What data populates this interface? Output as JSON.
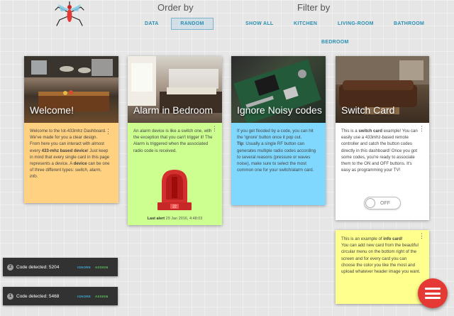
{
  "order_by": {
    "title": "Order by",
    "buttons": [
      {
        "label": "DATA",
        "active": false
      },
      {
        "label": "RANDOM",
        "active": true
      }
    ]
  },
  "filter_by": {
    "title": "Filter by",
    "buttons": [
      {
        "label": "SHOW ALL"
      },
      {
        "label": "KITCHEN"
      },
      {
        "label": "LIVING-ROOM"
      },
      {
        "label": "BATHROOM"
      },
      {
        "label": "BEDROOM"
      }
    ]
  },
  "cards": {
    "welcome": {
      "title": "Welcome!",
      "bg": "#ffd180",
      "body_html": "Welcome to the Iot-433mhz Dashboard. We've made for you a clear design.<br>From here you can interact with almost every <b>433-mhz based device</b>! Just keep in mind that every single card in this page represents a device. A <b>device</b> can be one of three different types: <i>switch, alarm, info</i>."
    },
    "alarm": {
      "title": "Alarm in Bedroom",
      "bg": "#ccff90",
      "body_html": "An alarm device is like a switch one, with the exception that you can't trigger it! The Alarm is triggered when the associated radio code is received.",
      "last_alert_label": "Last alert",
      "last_alert_value": "29 Jan 2016, 4:48:03"
    },
    "noisy": {
      "title": "Ignore Noisy codes",
      "bg": "#80d8ff",
      "body_html": "If you get flooded by a code, you can hit the 'ignore' button once it pop out.<br><b>Tip</b>: Usually a single RF button can generates multiple radio codes according to several reasons (pressure or waves noise), make sure to select the most common one for your switch/alarm card."
    },
    "switch": {
      "title": "Switch Card",
      "bg": "#ffffff",
      "body_html": "This is a <b>switch card</b> example! You can easily use a 433mhz-based remote controller and catch the button codes directly in this dashboard! Once you got some codes, you're ready to associate them to the ON and OFF buttons. It's easy as programming your TV!",
      "toggle_label": "OFF",
      "toggle_on": false
    },
    "info": {
      "bg": "#ffff8d",
      "body_html": "This is an example of <b>info card</b>!<br>You can add new card from the beautiful circular menu on the bottom right of the screen and for every card you can choose the color you like the most and upload whatever header image you want."
    }
  },
  "toasts": [
    {
      "num": "2",
      "text": "Code detected: 5204",
      "ignore": "IGNORE",
      "assign": "ASSIGN"
    },
    {
      "num": "1",
      "text": "Code detected: 5468",
      "ignore": "IGNORE",
      "assign": "ASSIGN"
    }
  ],
  "icons": {
    "logo": "mosquito-logo-icon",
    "card_menu": "more-vert-icon",
    "alarm": "siren-icon",
    "fab": "hamburger-menu-icon"
  },
  "colors": {
    "accent": "#2a8fb3",
    "fab": "#e53935",
    "toast_bg": "#323232"
  }
}
